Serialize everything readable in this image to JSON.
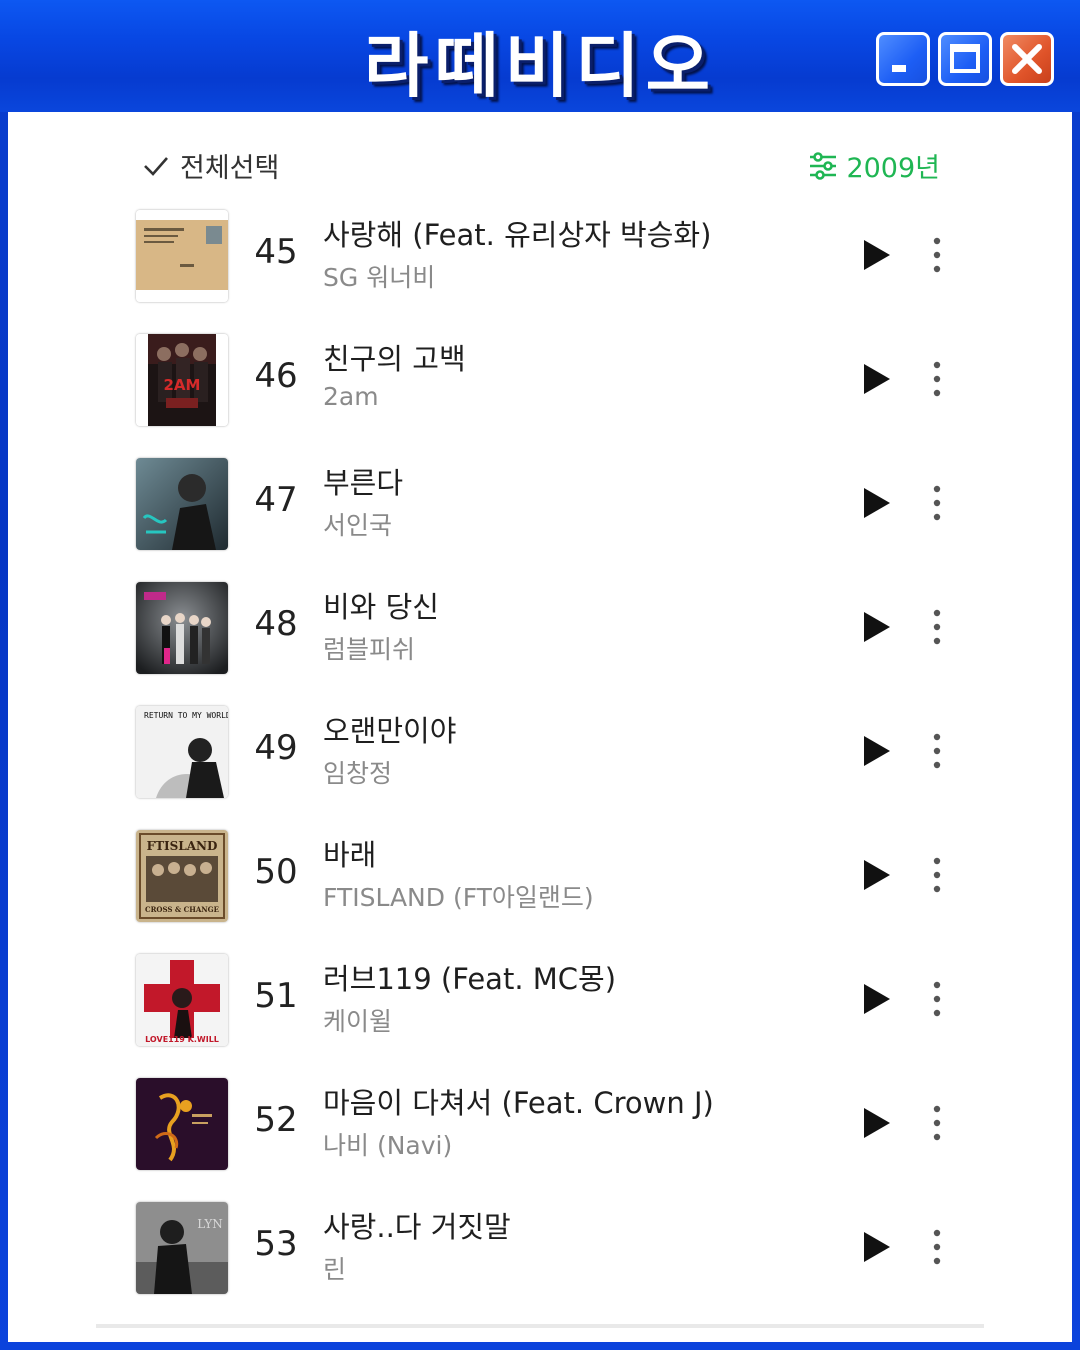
{
  "window": {
    "title": "라떼비디오",
    "controls": [
      "minimize-icon",
      "maximize-icon",
      "close-icon"
    ],
    "colors": {
      "titlebar": "#0847e3",
      "close": "#e0542a",
      "accent": "#1fb653"
    }
  },
  "toolbar": {
    "select_all_label": "전체선택",
    "year_filter_label": "2009년"
  },
  "tracks": [
    {
      "rank": "45",
      "title": "사랑해 (Feat. 유리상자 박승화)",
      "artist": "SG 워너비"
    },
    {
      "rank": "46",
      "title": "친구의 고백",
      "artist": "2am"
    },
    {
      "rank": "47",
      "title": "부른다",
      "artist": "서인국"
    },
    {
      "rank": "48",
      "title": "비와 당신",
      "artist": "럼블피쉬"
    },
    {
      "rank": "49",
      "title": "오랜만이야",
      "artist": "임창정"
    },
    {
      "rank": "50",
      "title": "바래",
      "artist": "FTISLAND (FT아일랜드)"
    },
    {
      "rank": "51",
      "title": "러브119 (Feat. MC몽)",
      "artist": "케이윌"
    },
    {
      "rank": "52",
      "title": "마음이 다쳐서 (Feat. Crown J)",
      "artist": "나비 (Navi)"
    },
    {
      "rank": "53",
      "title": "사랑..다 거짓말",
      "artist": "린"
    }
  ],
  "cover_art": {
    "45": {
      "logo_text": ""
    },
    "46": {
      "logo_text": "2AM"
    },
    "47": {
      "logo_text": ""
    },
    "48": {
      "logo_text": ""
    },
    "49": {
      "logo_text": "RETURN TO MY WORLD"
    },
    "50": {
      "logo_text": "FTISLAND",
      "sub_text": "CROSS & CHANGE"
    },
    "51": {
      "logo_text": "LOVE119 K.WILL"
    },
    "52": {
      "logo_text": ""
    },
    "53": {
      "logo_text": "LYN"
    }
  }
}
